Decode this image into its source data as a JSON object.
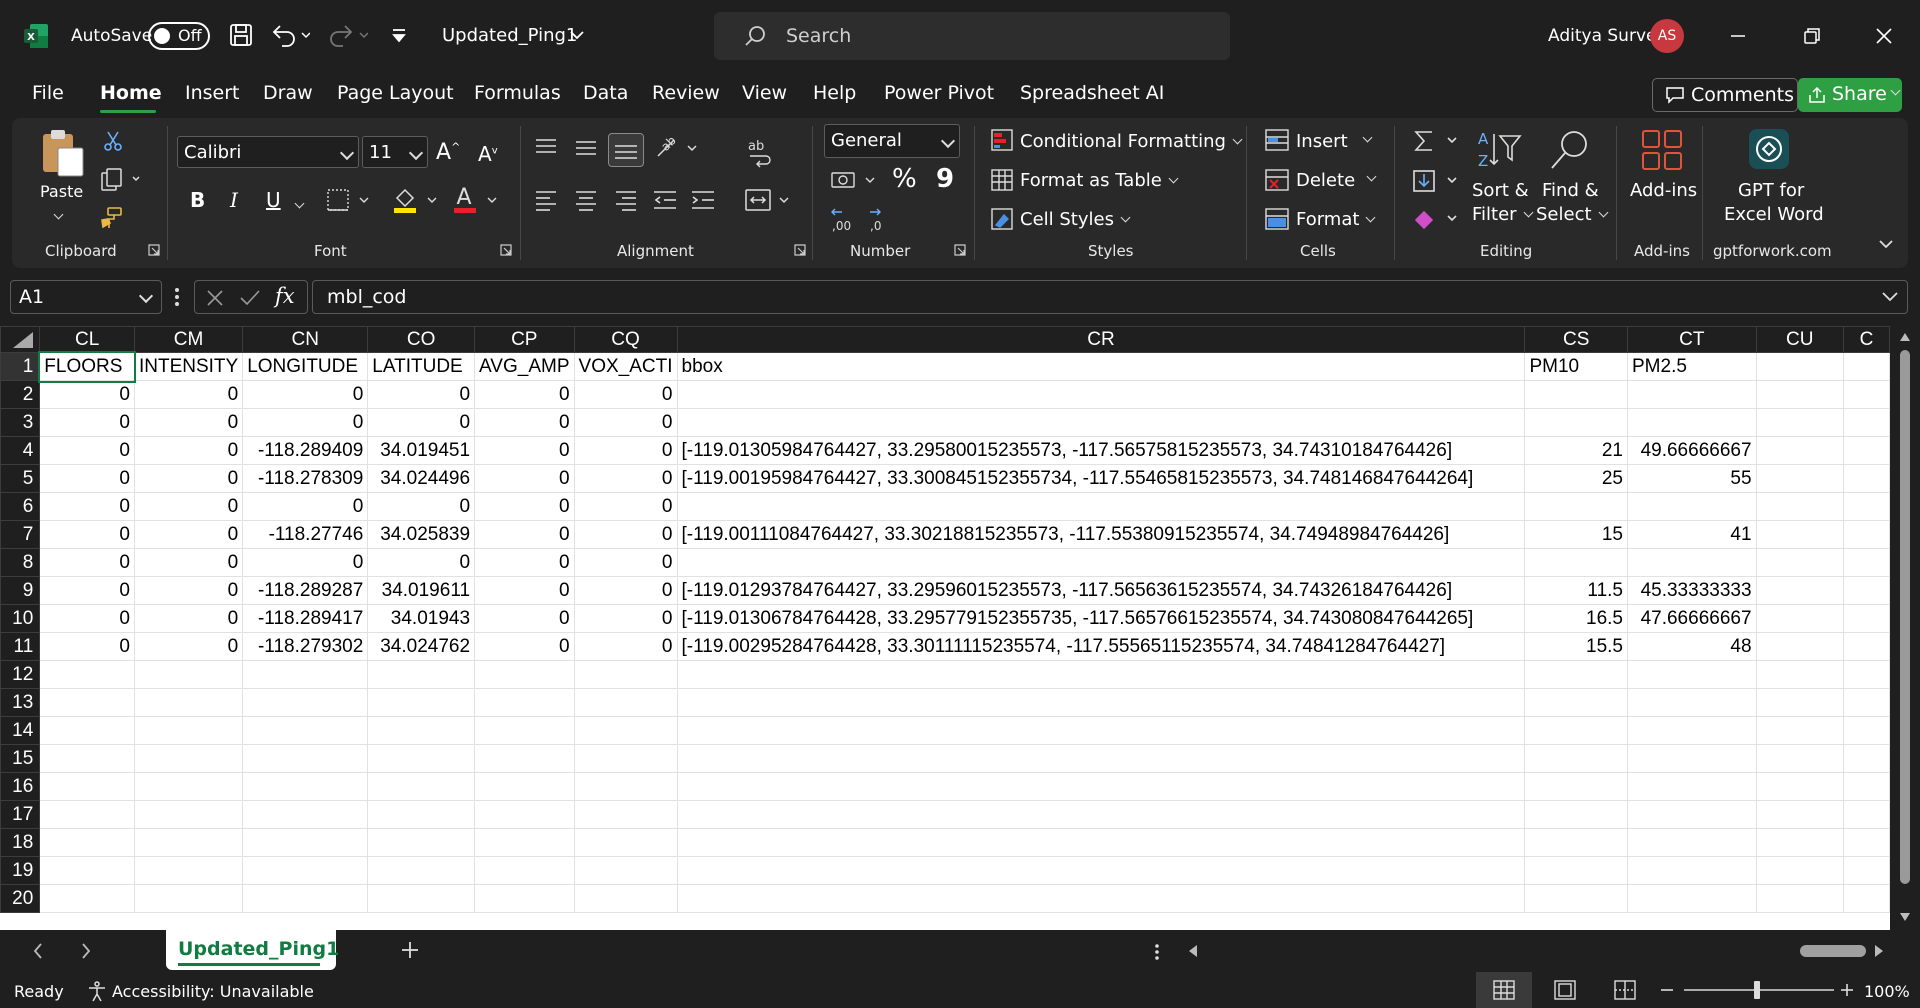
{
  "titlebar": {
    "autosave_label": "AutoSave",
    "autosave_state": "Off",
    "filename": "Updated_Ping1",
    "search_placeholder": "Search",
    "user_name": "Aditya Surve",
    "user_initials": "AS"
  },
  "menu": {
    "tabs": [
      "File",
      "Home",
      "Insert",
      "Draw",
      "Page Layout",
      "Formulas",
      "Data",
      "Review",
      "View",
      "Help",
      "Power Pivot",
      "Spreadsheet AI"
    ],
    "active": "Home",
    "comments_label": "Comments",
    "share_label": "Share"
  },
  "ribbon": {
    "clipboard": {
      "paste": "Paste",
      "group": "Clipboard"
    },
    "font": {
      "name": "Calibri",
      "size": "11",
      "bold": "B",
      "italic": "I",
      "underline": "U",
      "group": "Font"
    },
    "alignment": {
      "group": "Alignment"
    },
    "number": {
      "format": "General",
      "percent": "%",
      "comma": "9",
      "group": "Number"
    },
    "styles": {
      "conditional": "Conditional Formatting",
      "format_table": "Format as Table",
      "cell_styles": "Cell Styles",
      "group": "Styles"
    },
    "cells": {
      "insert": "Insert",
      "delete": "Delete",
      "format": "Format",
      "group": "Cells"
    },
    "editing": {
      "sort_l1": "Sort &",
      "sort_l2": "Filter",
      "find_l1": "Find &",
      "find_l2": "Select",
      "group": "Editing"
    },
    "addins": {
      "label": "Add-ins",
      "group": "Add-ins"
    },
    "gpt": {
      "l1": "GPT for",
      "l2": "Excel Word",
      "group": "gptforwork.com"
    }
  },
  "formula_bar": {
    "name_box": "A1",
    "fx": "fx",
    "content": "mbl_cod"
  },
  "sheet": {
    "columns": [
      "CL",
      "CM",
      "CN",
      "CO",
      "CP",
      "CQ",
      "CR",
      "CS",
      "CT",
      "CU",
      "C"
    ],
    "rows": [
      {
        "n": "1",
        "cells": [
          "FLOORS",
          "INTENSITY",
          "LONGITUDE",
          "LATITUDE",
          "AVG_AMP",
          "VOX_ACTI",
          "bbox",
          "PM10",
          "PM2.5",
          "",
          ""
        ]
      },
      {
        "n": "2",
        "cells": [
          "0",
          "0",
          "0",
          "0",
          "0",
          "0",
          "",
          "",
          "",
          "",
          ""
        ]
      },
      {
        "n": "3",
        "cells": [
          "0",
          "0",
          "0",
          "0",
          "0",
          "0",
          "",
          "",
          "",
          "",
          ""
        ]
      },
      {
        "n": "4",
        "cells": [
          "0",
          "0",
          "-118.289409",
          "34.019451",
          "0",
          "0",
          "[-119.01305984764427, 33.29580015235573, -117.56575815235573, 34.74310184764426]",
          "21",
          "49.66666667",
          "",
          ""
        ]
      },
      {
        "n": "5",
        "cells": [
          "0",
          "0",
          "-118.278309",
          "34.024496",
          "0",
          "0",
          "[-119.00195984764427, 33.300845152355734, -117.55465815235573, 34.748146847644264]",
          "25",
          "55",
          "",
          ""
        ]
      },
      {
        "n": "6",
        "cells": [
          "0",
          "0",
          "0",
          "0",
          "0",
          "0",
          "",
          "",
          "",
          "",
          ""
        ]
      },
      {
        "n": "7",
        "cells": [
          "0",
          "0",
          "-118.27746",
          "34.025839",
          "0",
          "0",
          "[-119.00111084764427, 33.30218815235573, -117.55380915235574, 34.74948984764426]",
          "15",
          "41",
          "",
          ""
        ]
      },
      {
        "n": "8",
        "cells": [
          "0",
          "0",
          "0",
          "0",
          "0",
          "0",
          "",
          "",
          "",
          "",
          ""
        ]
      },
      {
        "n": "9",
        "cells": [
          "0",
          "0",
          "-118.289287",
          "34.019611",
          "0",
          "0",
          "[-119.01293784764427, 33.29596015235573, -117.56563615235574, 34.74326184764426]",
          "11.5",
          "45.33333333",
          "",
          ""
        ]
      },
      {
        "n": "10",
        "cells": [
          "0",
          "0",
          "-118.289417",
          "34.01943",
          "0",
          "0",
          "[-119.01306784764428, 33.295779152355735, -117.56576615235574, 34.743080847644265]",
          "16.5",
          "47.66666667",
          "",
          ""
        ]
      },
      {
        "n": "11",
        "cells": [
          "0",
          "0",
          "-118.279302",
          "34.024762",
          "0",
          "0",
          "[-119.00295284764428, 33.30111115235574, -117.55565115235574, 34.74841284764427]",
          "15.5",
          "48",
          "",
          ""
        ]
      },
      {
        "n": "12",
        "cells": [
          "",
          "",
          "",
          "",
          "",
          "",
          "",
          "",
          "",
          "",
          ""
        ]
      },
      {
        "n": "13",
        "cells": [
          "",
          "",
          "",
          "",
          "",
          "",
          "",
          "",
          "",
          "",
          ""
        ]
      },
      {
        "n": "14",
        "cells": [
          "",
          "",
          "",
          "",
          "",
          "",
          "",
          "",
          "",
          "",
          ""
        ]
      },
      {
        "n": "15",
        "cells": [
          "",
          "",
          "",
          "",
          "",
          "",
          "",
          "",
          "",
          "",
          ""
        ]
      },
      {
        "n": "16",
        "cells": [
          "",
          "",
          "",
          "",
          "",
          "",
          "",
          "",
          "",
          "",
          ""
        ]
      },
      {
        "n": "17",
        "cells": [
          "",
          "",
          "",
          "",
          "",
          "",
          "",
          "",
          "",
          "",
          ""
        ]
      },
      {
        "n": "18",
        "cells": [
          "",
          "",
          "",
          "",
          "",
          "",
          "",
          "",
          "",
          "",
          ""
        ]
      },
      {
        "n": "19",
        "cells": [
          "",
          "",
          "",
          "",
          "",
          "",
          "",
          "",
          "",
          "",
          ""
        ]
      },
      {
        "n": "20",
        "cells": [
          "",
          "",
          "",
          "",
          "",
          "",
          "",
          "",
          "",
          "",
          ""
        ]
      }
    ]
  },
  "tabs": {
    "active_sheet": "Updated_Ping1"
  },
  "status": {
    "ready": "Ready",
    "accessibility": "Accessibility: Unavailable",
    "zoom": "100%"
  },
  "colors": {
    "accent": "#2ea043",
    "excel_green": "#107c41",
    "avatar": "#c7383f"
  }
}
